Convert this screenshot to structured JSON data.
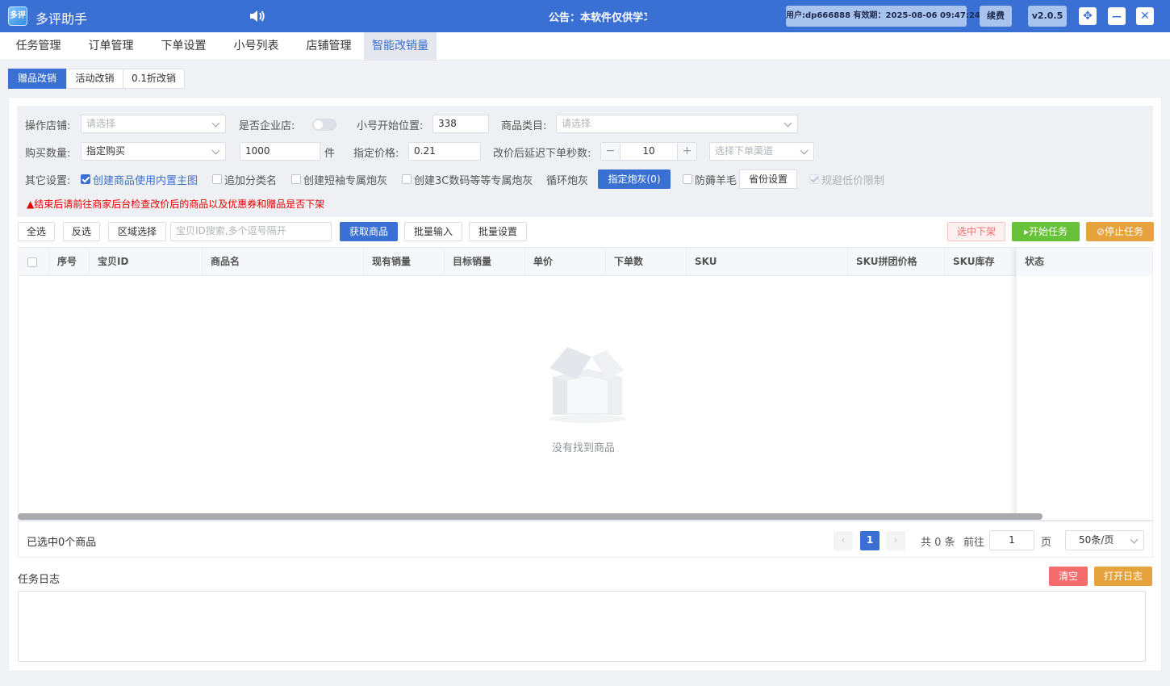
{
  "titlebar": {
    "app_name": "多评助手",
    "logo_text": "多评",
    "notice": "公告：本软件仅供学习交流使用",
    "user_info": "用户:dp666888 有效期：2025-08-06 09:47:24",
    "renew_label": "续费",
    "version_label": "v2.0.5",
    "move_symbol": "✥",
    "minimize_symbol": "—",
    "close_symbol": "✕"
  },
  "menu": {
    "items": [
      {
        "label": "任务管理"
      },
      {
        "label": "订单管理"
      },
      {
        "label": "下单设置"
      },
      {
        "label": "小号列表"
      },
      {
        "label": "店铺管理"
      },
      {
        "label": "智能改销量"
      }
    ],
    "active_index": 5
  },
  "subtabs": {
    "items": [
      {
        "label": "赠品改销"
      },
      {
        "label": "活动改销"
      },
      {
        "label": "0.1折改销"
      }
    ],
    "active_index": 0
  },
  "form": {
    "store_label": "操作店铺:",
    "store_placeholder": "请选择",
    "enterprise_label": "是否企业店:",
    "enterprise_on": false,
    "start_pos_label": "小号开始位置:",
    "start_pos_value": "338",
    "category_label": "商品类目:",
    "category_placeholder": "请选择",
    "buy_qty_label": "购买数量:",
    "buy_mode_value": "指定购买",
    "qty_value": "1000",
    "qty_unit": "件",
    "price_label": "指定价格:",
    "price_value": "0.21",
    "delay_label": "改价后延迟下单秒数:",
    "delay_value": "10",
    "stepper_minus": "−",
    "stepper_plus": "+",
    "channel_placeholder": "选择下单渠道",
    "other_label": "其它设置:",
    "opt_main_image": "创建商品使用内置主图",
    "opt_add_category": "追加分类名",
    "opt_short_sleeve": "创建短袖专属炮灰",
    "opt_3c": "创建3C数码等等专属炮灰",
    "loop_label": "循环炮灰",
    "assign_label": "指定炮灰(0)",
    "anti_label": "防薅羊毛",
    "province_label": "省份设置",
    "low_price_label": "规避低价限制",
    "warning": "▲结束后请前往商家后台检查改价后的商品以及优惠券和赠品是否下架"
  },
  "toolbar": {
    "select_all": "全选",
    "invert": "反选",
    "region": "区域选择",
    "search_placeholder": "宝贝ID搜索,多个逗号隔开",
    "fetch": "获取商品",
    "batch_input": "批量输入",
    "batch_set": "批量设置",
    "unlist_selected": "选中下架",
    "start_task": "开始任务",
    "stop_task": "停止任务"
  },
  "table": {
    "columns": [
      {
        "label": "序号"
      },
      {
        "label": "宝贝ID"
      },
      {
        "label": "商品名"
      },
      {
        "label": "现有销量"
      },
      {
        "label": "目标销量"
      },
      {
        "label": "单价"
      },
      {
        "label": "下单数"
      },
      {
        "label": "SKU"
      },
      {
        "label": "SKU拼团价格"
      },
      {
        "label": "SKU库存"
      }
    ],
    "status_column": "状态",
    "empty_text": "没有找到商品"
  },
  "pagination": {
    "selected_text": "已选中0个商品",
    "prev": "‹",
    "current_page": "1",
    "next": "›",
    "total": "共 0 条",
    "goto_label": "前往",
    "goto_value": "1",
    "page_unit": "页",
    "page_size": "50条/页"
  },
  "log": {
    "title": "任务日志",
    "clear": "清空",
    "open": "打开日志"
  },
  "colors": {
    "primary": "#3a6fd3",
    "success": "#67c23a",
    "warning": "#e6a23c",
    "danger": "#f56c6c"
  }
}
